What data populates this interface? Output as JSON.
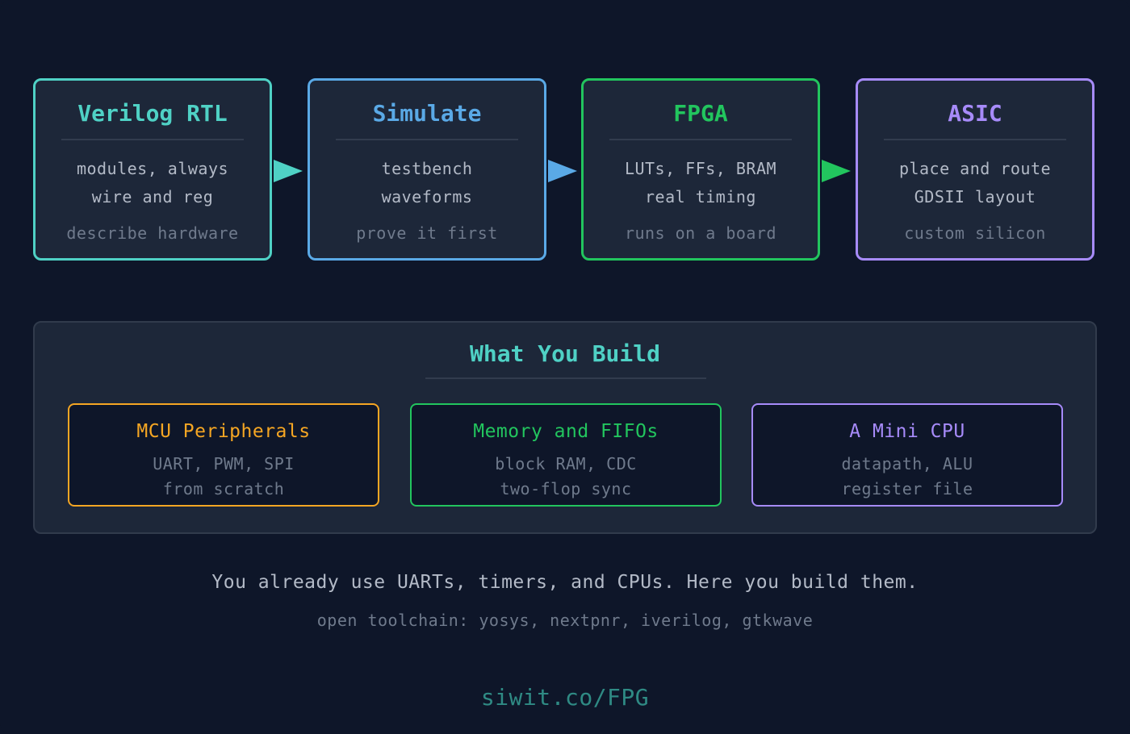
{
  "colors": {
    "background": "#0e1629",
    "card": "#1d2739",
    "teal": "#4fd1c5",
    "blue": "#5aa9e6",
    "green": "#22c55e",
    "purple": "#a78bfa",
    "orange": "#f5a623",
    "text": "#b3bac7",
    "muted": "#6f7a8c"
  },
  "pipeline": [
    {
      "title": "Verilog RTL",
      "line1": "modules, always",
      "line2": "wire and reg",
      "note": "describe hardware",
      "color": "#4fd1c5"
    },
    {
      "title": "Simulate",
      "line1": "testbench",
      "line2": "waveforms",
      "note": "prove it first",
      "color": "#5aa9e6"
    },
    {
      "title": "FPGA",
      "line1": "LUTs, FFs, BRAM",
      "line2": "real timing",
      "note": "runs on a board",
      "color": "#22c55e"
    },
    {
      "title": "ASIC",
      "line1": "place and route",
      "line2": "GDSII layout",
      "note": "custom silicon",
      "color": "#a78bfa"
    }
  ],
  "build": {
    "title": "What You Build",
    "cards": [
      {
        "title": "MCU Peripherals",
        "line1": "UART, PWM, SPI",
        "line2": "from scratch",
        "color": "#f5a623"
      },
      {
        "title": "Memory and FIFOs",
        "line1": "block RAM, CDC",
        "line2": "two-flop sync",
        "color": "#22c55e"
      },
      {
        "title": "A Mini CPU",
        "line1": "datapath, ALU",
        "line2": "register file",
        "color": "#a78bfa"
      }
    ]
  },
  "footer": {
    "tagline": "You already use UARTs, timers, and CPUs. Here you build them.",
    "toolchain": "open toolchain: yosys, nextpnr, iverilog, gtkwave",
    "url": "siwit.co/FPG"
  }
}
